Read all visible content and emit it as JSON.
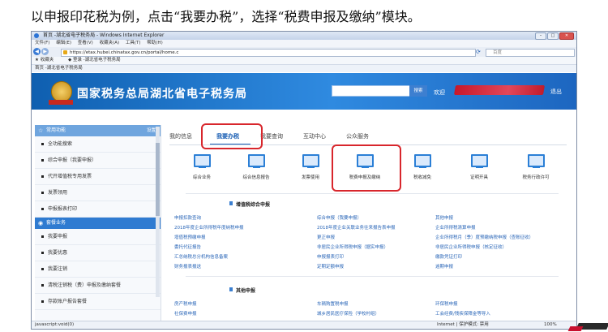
{
  "caption": "以申报印花税为例，点击“我要办税”，选择“税费申报及缴纳”模块。",
  "browser": {
    "title": "首页 -湖北省电子税务局 - Windows Internet Explorer",
    "menu": [
      "文件(F)",
      "编辑(E)",
      "查看(V)",
      "收藏夹(A)",
      "工具(T)",
      "帮助(H)"
    ],
    "url": "https://etax.hubei.chinatax.gov.cn/portal/home.c",
    "search_placeholder": "百度",
    "favorites": [
      "收藏夹",
      "登录 -湖北省电子税务局"
    ],
    "tab": "首页 -湖北省电子税务局",
    "status": "javascript:void(0)",
    "zone": "Internet | 保护模式: 禁用",
    "zoom": "100%"
  },
  "header": {
    "site_title": "国家税务总局湖北省电子税务局",
    "search_button": "搜索",
    "welcome": "欢迎",
    "logout": "退出"
  },
  "sidebar": {
    "common_title": "常用功能",
    "settings": "设置",
    "common_items": [
      "全功能搜索",
      "综合申报（我要申报）",
      "代开增值税专用发票",
      "发票领用",
      "申报报表打印"
    ],
    "business_title": "套餐业务",
    "business_items": [
      "我要申报",
      "我要优惠",
      "我要注销",
      "清税注销税（费）申报及缴纳套餐",
      "存款账户报告套餐"
    ]
  },
  "main": {
    "tabs": [
      "我的信息",
      "我要办税",
      "我要查询",
      "互动中心",
      "公众服务"
    ],
    "icons": [
      "综合业务",
      "综合信息报告",
      "发票使用",
      "税费申报及缴纳",
      "税收减免",
      "证明开具",
      "税务行政许可"
    ],
    "section1_title": "增值税综合申报",
    "section1_links": [
      [
        "申报扣款查询",
        "综合申报（我要申报）",
        "其他申报"
      ],
      [
        "2018年度企业所得税年度纳税申报",
        "2018年度企业关联业务往来报告表申报",
        "企业所得税清算申报"
      ],
      [
        "增值税预缴申报",
        "更正申报",
        "企业所得税月（季）度预缴纳税申报（查账征收）"
      ],
      [
        "委托代征报告",
        "非居民企业所得税申报（据实申报）",
        "非居民企业所得税申报（核定征收）"
      ],
      [
        "汇总纳税总分机构信息备案",
        "申报报表打印",
        "缴款凭证打印"
      ],
      [
        "财务报表报送",
        "定期定额申报",
        "逾期申报"
      ]
    ],
    "section2_title": "其他申报",
    "section2_links": [
      [
        "房产税申报",
        "车辆购置税申报",
        "环保税申报"
      ],
      [
        "社保费申报",
        "城乡居民医疗保险（学校村组）",
        "工会经费/残疾保障金等导入"
      ]
    ]
  }
}
